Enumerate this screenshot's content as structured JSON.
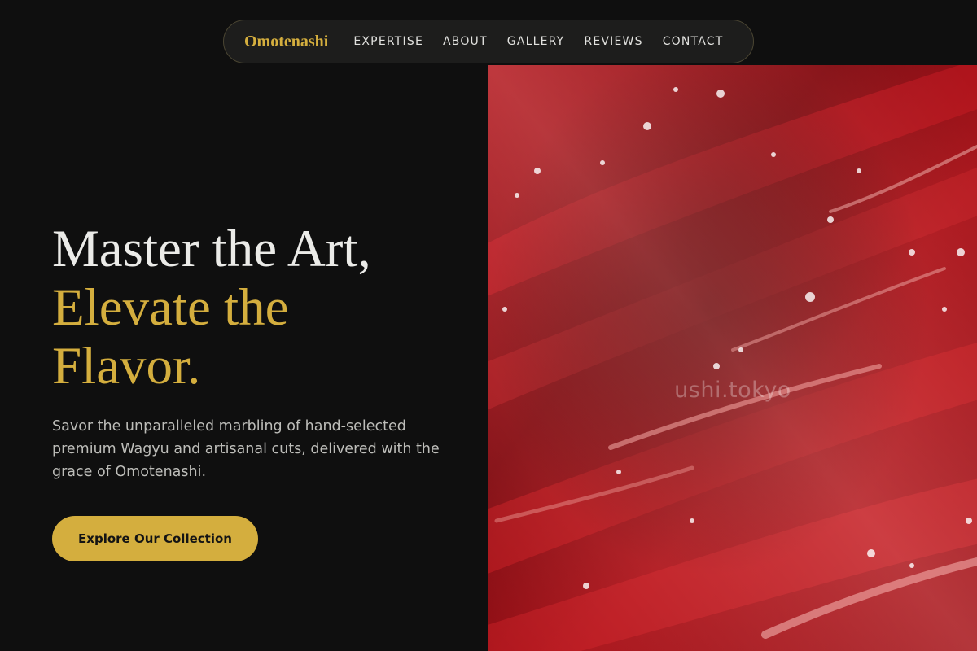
{
  "nav": {
    "brand": "Omotenashi",
    "links": [
      {
        "label": "EXPERTISE"
      },
      {
        "label": "ABOUT"
      },
      {
        "label": "GALLERY"
      },
      {
        "label": "REVIEWS"
      },
      {
        "label": "CONTACT"
      }
    ]
  },
  "hero": {
    "headline_line1": "Master the Art,",
    "headline_line2": "Elevate the",
    "headline_line3": "Flavor.",
    "subtext": "Savor the unparalleled marbling of hand-selected premium Wagyu and artisanal cuts, delivered with the grace of Omotenashi.",
    "cta_label": "Explore Our Collection",
    "image_watermark": "ushi.tokyo"
  },
  "colors": {
    "background": "#0f0f0f",
    "accent_gold": "#d4ae3e",
    "headline_white": "#ebebe8",
    "body_text": "#bdbdb9",
    "meat_red": "#b3141c"
  }
}
